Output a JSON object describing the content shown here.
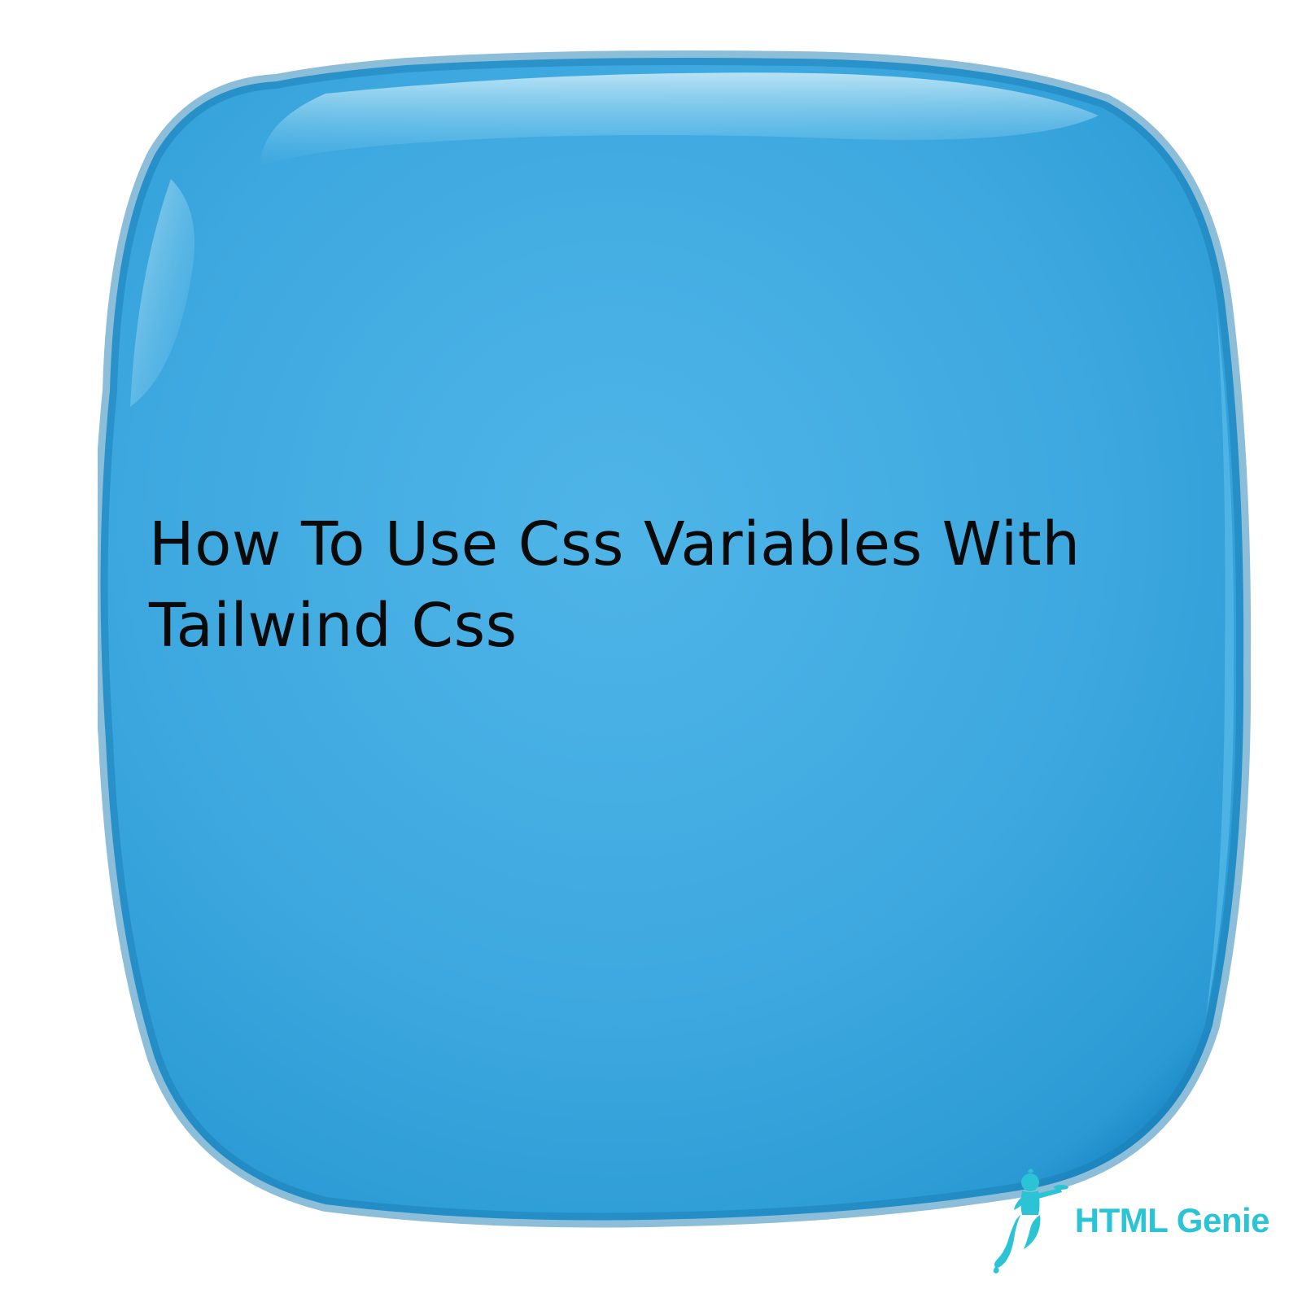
{
  "title": "How To Use Css Variables With\n Tailwind Css",
  "logo": {
    "text": "HTML Genie"
  },
  "colors": {
    "blob_main": "#3DA8DF",
    "blob_edge": "#2B9AD4",
    "blob_highlight": "#7FCFF0",
    "logo_accent": "#2bc4d4"
  }
}
